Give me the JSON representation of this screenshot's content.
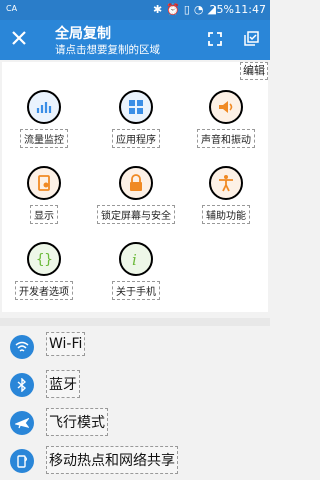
{
  "status_bar": {
    "carrier": "CA",
    "battery_pct": "25%",
    "time": "11:47"
  },
  "app_bar": {
    "title": "全局复制",
    "subtitle": "请点击想要复制的区域",
    "close_icon": "close-icon",
    "expand_icon": "expand-icon",
    "copy_icon": "copy-check-icon"
  },
  "edit_label": "编辑",
  "grid": [
    {
      "label": "流量监控",
      "icon": "bar-chart-icon",
      "color": "#3a8ee6"
    },
    {
      "label": "应用程序",
      "icon": "apps-grid-icon",
      "color": "#3a8ee6"
    },
    {
      "label": "声音和振动",
      "icon": "speaker-icon",
      "color": "#f08a24"
    },
    {
      "label": "显示",
      "icon": "display-icon",
      "color": "#f08a24"
    },
    {
      "label": "锁定屏幕与安全",
      "icon": "lock-icon",
      "color": "#f08a24"
    },
    {
      "label": "辅助功能",
      "icon": "accessibility-icon",
      "color": "#f08a24"
    },
    {
      "label": "开发者选项",
      "icon": "braces-icon",
      "color": "#6cba3a"
    },
    {
      "label": "关于手机",
      "icon": "info-icon",
      "color": "#6cba3a"
    }
  ],
  "list": [
    {
      "label": "Wi-Fi",
      "icon": "wifi-icon"
    },
    {
      "label": "蓝牙",
      "icon": "bluetooth-icon"
    },
    {
      "label": "飞行模式",
      "icon": "airplane-icon"
    },
    {
      "label": "移动热点和网络共享",
      "icon": "hotspot-icon"
    }
  ]
}
